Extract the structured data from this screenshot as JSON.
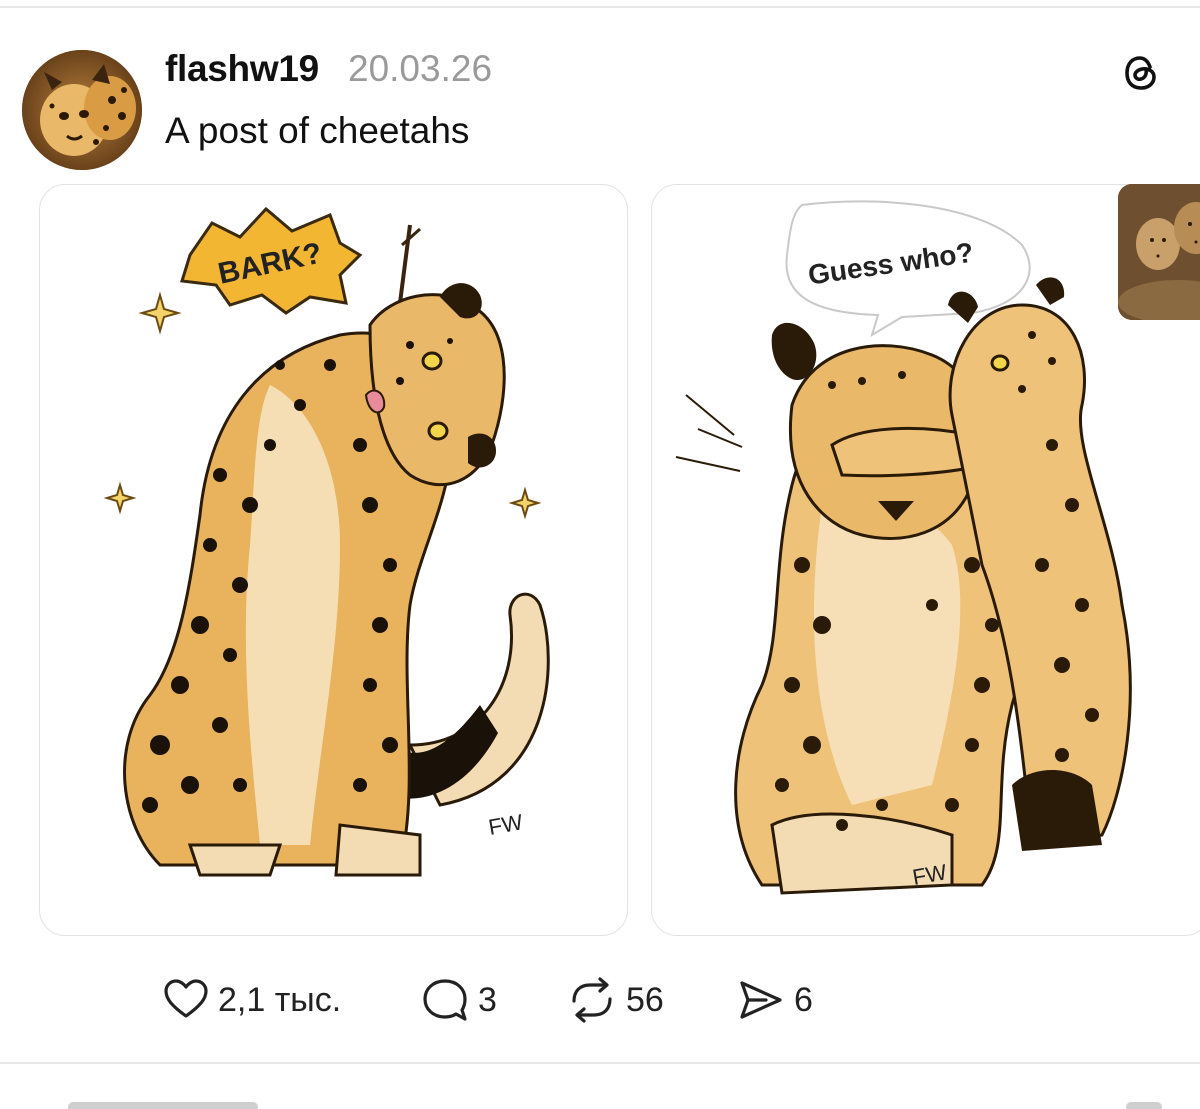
{
  "post": {
    "username": "flashw19",
    "date": "20.03.26",
    "text": "A post of cheetahs",
    "avatar_icon": "cheetah-avatar",
    "app_icon": "threads-logo-icon"
  },
  "media": [
    {
      "caption_text": "BARK?",
      "signature": "FW"
    },
    {
      "caption_text": "Guess who?",
      "signature": "FW"
    },
    {
      "caption_text": ""
    }
  ],
  "actions": {
    "like": {
      "icon": "heart-icon",
      "count": "2,1 тыс."
    },
    "comment": {
      "icon": "comment-icon",
      "count": "3"
    },
    "repost": {
      "icon": "repost-icon",
      "count": "56"
    },
    "share": {
      "icon": "send-icon",
      "count": "6"
    }
  },
  "colors": {
    "text_primary": "#111111",
    "text_secondary": "#9a9a9a",
    "cheetah_fur": "#e8b35c",
    "cheetah_spots": "#1a1208",
    "bark_burst": "#f2b632"
  }
}
